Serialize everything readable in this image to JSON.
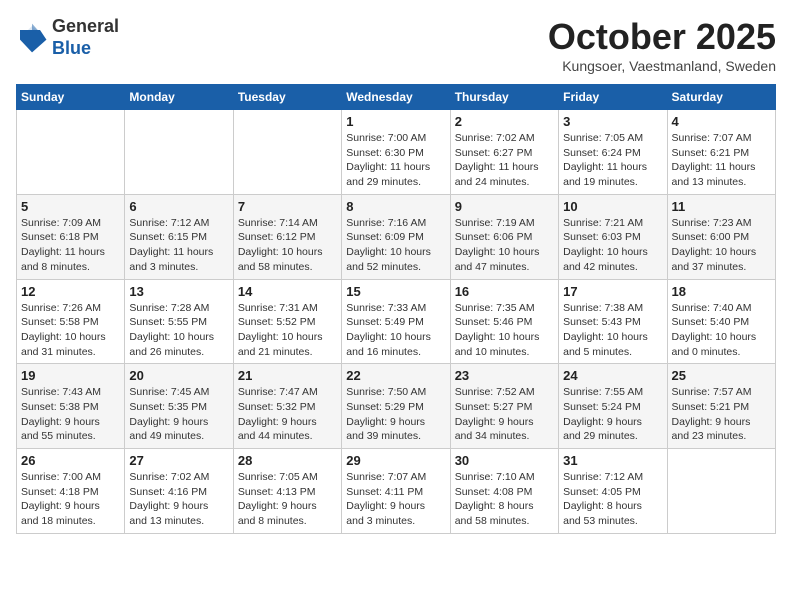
{
  "header": {
    "logo_general": "General",
    "logo_blue": "Blue",
    "month": "October 2025",
    "location": "Kungsoer, Vaestmanland, Sweden"
  },
  "days_of_week": [
    "Sunday",
    "Monday",
    "Tuesday",
    "Wednesday",
    "Thursday",
    "Friday",
    "Saturday"
  ],
  "weeks": [
    [
      {
        "day": "",
        "info": ""
      },
      {
        "day": "",
        "info": ""
      },
      {
        "day": "",
        "info": ""
      },
      {
        "day": "1",
        "info": "Sunrise: 7:00 AM\nSunset: 6:30 PM\nDaylight: 11 hours\nand 29 minutes."
      },
      {
        "day": "2",
        "info": "Sunrise: 7:02 AM\nSunset: 6:27 PM\nDaylight: 11 hours\nand 24 minutes."
      },
      {
        "day": "3",
        "info": "Sunrise: 7:05 AM\nSunset: 6:24 PM\nDaylight: 11 hours\nand 19 minutes."
      },
      {
        "day": "4",
        "info": "Sunrise: 7:07 AM\nSunset: 6:21 PM\nDaylight: 11 hours\nand 13 minutes."
      }
    ],
    [
      {
        "day": "5",
        "info": "Sunrise: 7:09 AM\nSunset: 6:18 PM\nDaylight: 11 hours\nand 8 minutes."
      },
      {
        "day": "6",
        "info": "Sunrise: 7:12 AM\nSunset: 6:15 PM\nDaylight: 11 hours\nand 3 minutes."
      },
      {
        "day": "7",
        "info": "Sunrise: 7:14 AM\nSunset: 6:12 PM\nDaylight: 10 hours\nand 58 minutes."
      },
      {
        "day": "8",
        "info": "Sunrise: 7:16 AM\nSunset: 6:09 PM\nDaylight: 10 hours\nand 52 minutes."
      },
      {
        "day": "9",
        "info": "Sunrise: 7:19 AM\nSunset: 6:06 PM\nDaylight: 10 hours\nand 47 minutes."
      },
      {
        "day": "10",
        "info": "Sunrise: 7:21 AM\nSunset: 6:03 PM\nDaylight: 10 hours\nand 42 minutes."
      },
      {
        "day": "11",
        "info": "Sunrise: 7:23 AM\nSunset: 6:00 PM\nDaylight: 10 hours\nand 37 minutes."
      }
    ],
    [
      {
        "day": "12",
        "info": "Sunrise: 7:26 AM\nSunset: 5:58 PM\nDaylight: 10 hours\nand 31 minutes."
      },
      {
        "day": "13",
        "info": "Sunrise: 7:28 AM\nSunset: 5:55 PM\nDaylight: 10 hours\nand 26 minutes."
      },
      {
        "day": "14",
        "info": "Sunrise: 7:31 AM\nSunset: 5:52 PM\nDaylight: 10 hours\nand 21 minutes."
      },
      {
        "day": "15",
        "info": "Sunrise: 7:33 AM\nSunset: 5:49 PM\nDaylight: 10 hours\nand 16 minutes."
      },
      {
        "day": "16",
        "info": "Sunrise: 7:35 AM\nSunset: 5:46 PM\nDaylight: 10 hours\nand 10 minutes."
      },
      {
        "day": "17",
        "info": "Sunrise: 7:38 AM\nSunset: 5:43 PM\nDaylight: 10 hours\nand 5 minutes."
      },
      {
        "day": "18",
        "info": "Sunrise: 7:40 AM\nSunset: 5:40 PM\nDaylight: 10 hours\nand 0 minutes."
      }
    ],
    [
      {
        "day": "19",
        "info": "Sunrise: 7:43 AM\nSunset: 5:38 PM\nDaylight: 9 hours\nand 55 minutes."
      },
      {
        "day": "20",
        "info": "Sunrise: 7:45 AM\nSunset: 5:35 PM\nDaylight: 9 hours\nand 49 minutes."
      },
      {
        "day": "21",
        "info": "Sunrise: 7:47 AM\nSunset: 5:32 PM\nDaylight: 9 hours\nand 44 minutes."
      },
      {
        "day": "22",
        "info": "Sunrise: 7:50 AM\nSunset: 5:29 PM\nDaylight: 9 hours\nand 39 minutes."
      },
      {
        "day": "23",
        "info": "Sunrise: 7:52 AM\nSunset: 5:27 PM\nDaylight: 9 hours\nand 34 minutes."
      },
      {
        "day": "24",
        "info": "Sunrise: 7:55 AM\nSunset: 5:24 PM\nDaylight: 9 hours\nand 29 minutes."
      },
      {
        "day": "25",
        "info": "Sunrise: 7:57 AM\nSunset: 5:21 PM\nDaylight: 9 hours\nand 23 minutes."
      }
    ],
    [
      {
        "day": "26",
        "info": "Sunrise: 7:00 AM\nSunset: 4:18 PM\nDaylight: 9 hours\nand 18 minutes."
      },
      {
        "day": "27",
        "info": "Sunrise: 7:02 AM\nSunset: 4:16 PM\nDaylight: 9 hours\nand 13 minutes."
      },
      {
        "day": "28",
        "info": "Sunrise: 7:05 AM\nSunset: 4:13 PM\nDaylight: 9 hours\nand 8 minutes."
      },
      {
        "day": "29",
        "info": "Sunrise: 7:07 AM\nSunset: 4:11 PM\nDaylight: 9 hours\nand 3 minutes."
      },
      {
        "day": "30",
        "info": "Sunrise: 7:10 AM\nSunset: 4:08 PM\nDaylight: 8 hours\nand 58 minutes."
      },
      {
        "day": "31",
        "info": "Sunrise: 7:12 AM\nSunset: 4:05 PM\nDaylight: 8 hours\nand 53 minutes."
      },
      {
        "day": "",
        "info": ""
      }
    ]
  ]
}
